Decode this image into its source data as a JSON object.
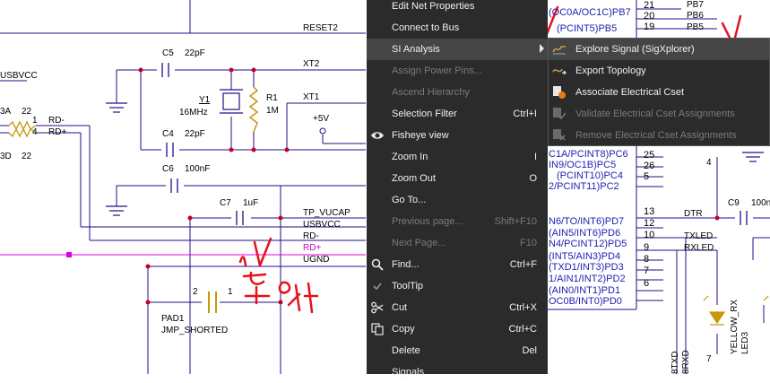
{
  "schematic": {
    "net_labels": {
      "reset2": "RESET2",
      "xt2": "XT2",
      "xt1": "XT1",
      "tp_vucap": "TP_VUCAP",
      "usbvcc": "USBVCC",
      "rd_minus": "RD-",
      "rd_plus": "RD+",
      "ugnd": "UGND",
      "usbvcc_left": "USBVCC",
      "rd_minus_left": "RD-",
      "rd_plus_left": "RD+",
      "dtr": "DTR",
      "txled": "TXLED",
      "rxled": "RXLED",
      "vcc5": "+5V"
    },
    "components": {
      "c5_ref": "C5",
      "c5_val": "22pF",
      "c4_ref": "C4",
      "c4_val": "22pF",
      "c6_ref": "C6",
      "c6_val": "100nF",
      "c7_ref": "C7",
      "c7_val": "1uF",
      "c9_ref": "C9",
      "c9_val": "100n",
      "y1_ref": "Y1",
      "y1_val": "16MHz",
      "r1_ref": "R1",
      "r1_val": "1M",
      "pad1_ref": "PAD1",
      "pad1_val": "JMP_SHORTED",
      "pad1_pin2": "2",
      "pad1_pin1": "1",
      "rn_3a": "3A",
      "rn_22a": "22",
      "rn_3d": "3D",
      "rn_22b": "22",
      "rn_pin1": "1",
      "rn_pin4": "4",
      "led3_ref": "LED3",
      "led3_val": "YELLOW_RX",
      "pin4_right": "4"
    },
    "ic_pins": [
      {
        "label": "(OC0A/OC1C)PB7",
        "num": "21",
        "net": "PB7"
      },
      {
        "label": "",
        "num": "20",
        "net": "PB6"
      },
      {
        "label": "(PCINT5)PB5",
        "num": "19",
        "net": "PB5"
      },
      {
        "label": "C1A/PCINT8)PC6",
        "num": "25",
        "net": ""
      },
      {
        "label": "IN9/OC1B)PC5",
        "num": "26",
        "net": ""
      },
      {
        "label": "(PCINT10)PC4",
        "num": "5",
        "net": ""
      },
      {
        "label": "2/PCINT11)PC2",
        "num": "5",
        "net": ""
      },
      {
        "label": "N6/TO/INT6)PD7",
        "num": "13",
        "net": ""
      },
      {
        "label": "(AIN5/INT6)PD6",
        "num": "12",
        "net": ""
      },
      {
        "label": "N4/PCINT12)PD5",
        "num": "10",
        "net": ""
      },
      {
        "label": "(INT5/AIN3)PD4",
        "num": "9",
        "net": ""
      },
      {
        "label": "(TXD1/INT3)PD3",
        "num": "8",
        "net": ""
      },
      {
        "label": "1/AIN1/INT2)PD2",
        "num": "7",
        "net": ""
      },
      {
        "label": "(AIN0/INT1)PD1",
        "num": "6",
        "net": ""
      },
      {
        "label": "OC0B/INT0)PD0",
        "num": "",
        "net": ""
      }
    ],
    "bottom_pins": [
      "8TXD",
      "8RXD"
    ],
    "pin7": "7"
  },
  "context_menu": {
    "items": [
      {
        "label": "Edit Net Properties",
        "shortcut": "",
        "icon": "",
        "disabled": false
      },
      {
        "label": "Connect to Bus",
        "shortcut": "",
        "icon": "",
        "disabled": false
      },
      {
        "label": "SI Analysis",
        "shortcut": "",
        "icon": "",
        "disabled": false,
        "submenu": true,
        "highlighted": true
      },
      {
        "label": "Assign Power Pins...",
        "shortcut": "",
        "icon": "",
        "disabled": true
      },
      {
        "label": "Ascend Hierarchy",
        "shortcut": "",
        "icon": "",
        "disabled": true
      },
      {
        "label": "Selection Filter",
        "shortcut": "Ctrl+I",
        "icon": "",
        "disabled": false
      },
      {
        "label": "Fisheye view",
        "shortcut": "",
        "icon": "eye-icon",
        "disabled": false
      },
      {
        "label": "Zoom In",
        "shortcut": "I",
        "icon": "",
        "disabled": false
      },
      {
        "label": "Zoom Out",
        "shortcut": "O",
        "icon": "",
        "disabled": false
      },
      {
        "label": "Go To...",
        "shortcut": "",
        "icon": "",
        "disabled": false
      },
      {
        "label": "Previous page...",
        "shortcut": "Shift+F10",
        "icon": "",
        "disabled": true
      },
      {
        "label": "Next Page...",
        "shortcut": "F10",
        "icon": "",
        "disabled": true
      },
      {
        "label": "Find...",
        "shortcut": "Ctrl+F",
        "icon": "search-icon",
        "disabled": false
      },
      {
        "label": "ToolTip",
        "shortcut": "",
        "icon": "check-icon",
        "disabled": false
      },
      {
        "label": "Cut",
        "shortcut": "Ctrl+X",
        "icon": "scissors-icon",
        "disabled": false
      },
      {
        "label": "Copy",
        "shortcut": "Ctrl+C",
        "icon": "copy-icon",
        "disabled": false
      },
      {
        "label": "Delete",
        "shortcut": "Del",
        "icon": "",
        "disabled": false
      },
      {
        "label": "Signals",
        "shortcut": "",
        "icon": "",
        "disabled": false
      }
    ]
  },
  "submenu": {
    "items": [
      {
        "label": "Explore Signal (SigXplorer)",
        "icon": "explore-signal-icon",
        "disabled": false,
        "highlighted": true
      },
      {
        "label": "Export Topology",
        "icon": "export-topology-icon",
        "disabled": false
      },
      {
        "label": "Associate Electrical Cset",
        "icon": "associate-cset-icon",
        "disabled": false
      },
      {
        "label": "Validate Electrical Cset Assignments",
        "icon": "validate-cset-icon",
        "disabled": true
      },
      {
        "label": "Remove Electrical Cset Assignments",
        "icon": "remove-cset-icon",
        "disabled": true
      }
    ]
  },
  "colors": {
    "wire": "#2a0a8a",
    "junction": "#c0002a",
    "pink_net": "#e000e0",
    "menu_bg": "#2b2b2b",
    "menu_highlight": "#454545",
    "annotation_red": "#e8101a",
    "pin_text_blue": "#1f1fb0",
    "cap_gold": "#c8960a"
  }
}
